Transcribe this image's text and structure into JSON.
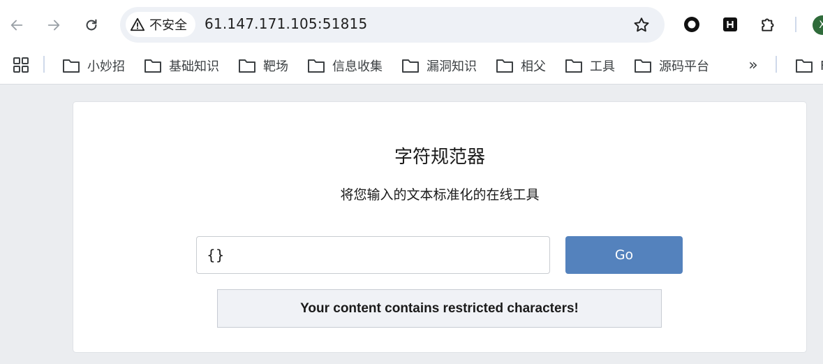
{
  "browser": {
    "security_label": "不安全",
    "url": "61.147.171.105:51815",
    "profile_initial": "X"
  },
  "bookmarks": {
    "items": [
      {
        "label": "小妙招"
      },
      {
        "label": "基础知识"
      },
      {
        "label": "靶场"
      },
      {
        "label": "信息收集"
      },
      {
        "label": "漏洞知识"
      },
      {
        "label": "相父"
      },
      {
        "label": "工具"
      },
      {
        "label": "源码平台"
      }
    ],
    "more_label": "»",
    "overflow_folder_partial": "F"
  },
  "page": {
    "title": "字符规范器",
    "subtitle": "将您输入的文本标准化的在线工具",
    "input_value": "{}",
    "go_label": "Go",
    "message": "Your content contains restricted characters!"
  },
  "colors": {
    "button": "#5482bd",
    "omnibox": "#eef1f6",
    "page_bg": "#ebedf0"
  }
}
